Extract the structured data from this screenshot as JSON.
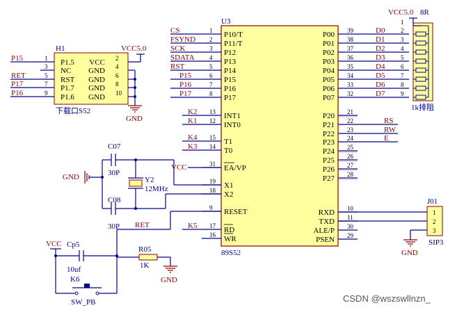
{
  "power_labels": {
    "vcc50_top": "VCC5.0",
    "vcc50_h1": "VCC5.0",
    "vcc_ea": "VCC",
    "vcc_reset": "VCC",
    "gnd": "GND"
  },
  "u3": {
    "ref": "U3",
    "part": "89S52",
    "left_pins": [
      {
        "num": "1",
        "name": "P10/T",
        "net": "CS"
      },
      {
        "num": "2",
        "name": "P11/T",
        "net": "FSYND"
      },
      {
        "num": "3",
        "name": "P12",
        "net": "SCK"
      },
      {
        "num": "4",
        "name": "P13",
        "net": "SDATA"
      },
      {
        "num": "5",
        "name": "P14",
        "net": "RST"
      },
      {
        "num": "6",
        "name": "P15",
        "net": "P15"
      },
      {
        "num": "7",
        "name": "P16",
        "net": "P16"
      },
      {
        "num": "8",
        "name": "P17",
        "net": "P17"
      },
      {
        "num": "13",
        "name": "INT1",
        "net": "K2"
      },
      {
        "num": "12",
        "name": "INT0",
        "net": "K1"
      },
      {
        "num": "15",
        "name": "T1",
        "net": "K4"
      },
      {
        "num": "14",
        "name": "T0",
        "net": "K3"
      },
      {
        "num": "31",
        "name": "EA/VP",
        "net": ""
      },
      {
        "num": "19",
        "name": "X1",
        "net": ""
      },
      {
        "num": "18",
        "name": "X2",
        "net": ""
      },
      {
        "num": "9",
        "name": "RESET",
        "net": ""
      },
      {
        "num": "17",
        "name": "RD",
        "net": "K5"
      },
      {
        "num": "16",
        "name": "WR",
        "net": ""
      }
    ],
    "right_pins": [
      {
        "num": "39",
        "name": "P00",
        "net": "D0"
      },
      {
        "num": "38",
        "name": "P01",
        "net": "D1"
      },
      {
        "num": "37",
        "name": "P02",
        "net": "D2"
      },
      {
        "num": "36",
        "name": "P03",
        "net": "D3"
      },
      {
        "num": "35",
        "name": "P04",
        "net": "D4"
      },
      {
        "num": "34",
        "name": "P05",
        "net": "D5"
      },
      {
        "num": "33",
        "name": "P06",
        "net": "D6"
      },
      {
        "num": "32",
        "name": "P07",
        "net": "D7"
      },
      {
        "num": "21",
        "name": "P20",
        "net": ""
      },
      {
        "num": "22",
        "name": "P21",
        "net": "RS"
      },
      {
        "num": "23",
        "name": "P22",
        "net": "RW"
      },
      {
        "num": "24",
        "name": "P23",
        "net": "E"
      },
      {
        "num": "25",
        "name": "P24",
        "net": ""
      },
      {
        "num": "26",
        "name": "P25",
        "net": ""
      },
      {
        "num": "27",
        "name": "P26",
        "net": ""
      },
      {
        "num": "28",
        "name": "P27",
        "net": ""
      },
      {
        "num": "10",
        "name": "RXD",
        "net": ""
      },
      {
        "num": "11",
        "name": "TXD",
        "net": ""
      },
      {
        "num": "30",
        "name": "ALE/P",
        "net": ""
      },
      {
        "num": "29",
        "name": "PSEN",
        "net": ""
      }
    ]
  },
  "h1": {
    "ref": "H1",
    "caption": "下载口S52",
    "rows": [
      {
        "lnum": "1",
        "lname": "P1.5",
        "rname": "VCC",
        "rnum": "2",
        "net": "P15"
      },
      {
        "lnum": "3",
        "lname": "NC",
        "rname": "GND",
        "rnum": "4",
        "net": ""
      },
      {
        "lnum": "5",
        "lname": "RST",
        "rname": "GND",
        "rnum": "6",
        "net": "RET"
      },
      {
        "lnum": "7",
        "lname": "P1.7",
        "rname": "GND",
        "rnum": "8",
        "net": "P17"
      },
      {
        "lnum": "9",
        "lname": "P1.6",
        "rname": "GND",
        "rnum": "10",
        "net": "P16"
      }
    ]
  },
  "rp": {
    "ref": "8R",
    "caption": "1k排阻",
    "pins": [
      "1",
      "2",
      "3",
      "4",
      "5",
      "6",
      "7",
      "8",
      "9"
    ]
  },
  "j01": {
    "ref": "J01",
    "caption": "SIP3",
    "pins": [
      "1",
      "2",
      "3"
    ]
  },
  "c07": {
    "ref": "C07",
    "value": "30P"
  },
  "c08": {
    "ref": "C08",
    "value": "30P"
  },
  "y2": {
    "ref": "Y2",
    "value": "12MHz"
  },
  "cp5": {
    "ref": "Cp5",
    "value": "10uf"
  },
  "r05": {
    "ref": "R05",
    "value": "1K"
  },
  "k6": {
    "ref": "K6",
    "caption": "SW_PB"
  },
  "net_ret": "RET",
  "watermark": "CSDN @wszswllnzn_"
}
